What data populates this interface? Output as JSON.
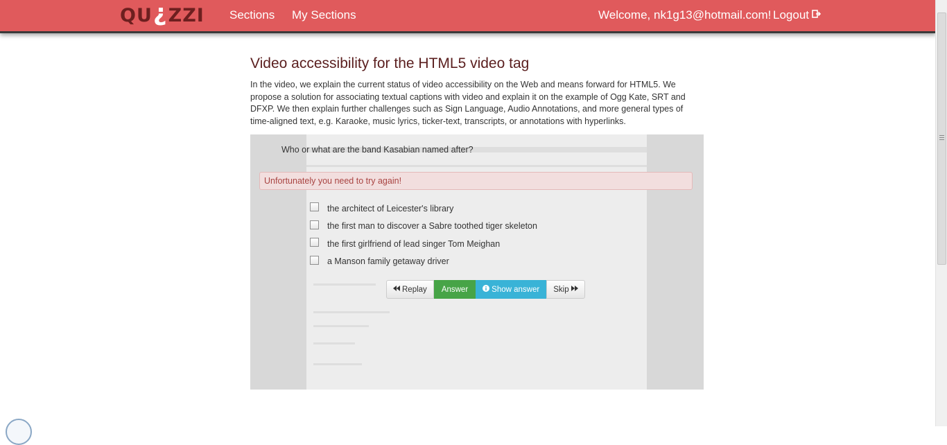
{
  "navbar": {
    "logo_left": "QU",
    "logo_mark": "¿",
    "logo_right": "ZZI",
    "links": [
      {
        "label": "Sections"
      },
      {
        "label": "My Sections"
      }
    ],
    "welcome": "Welcome, nk1g13@hotmail.com!",
    "logout": "Logout",
    "accent_color": "#e05a5c"
  },
  "page": {
    "title": "Video accessibility for the HTML5 video tag",
    "description": "In the video, we explain the current status of video accessibility on the Web and means forward for HTML5. We propose a solution for associating textual captions with video and explain it on the example of Ogg Kate, SRT and DFXP. We then explain further challenges such as Sign Language, Audio Annotations, and more general types of time-aligned text, e.g. Karaoke, music lyrics, ticker-text, transcripts, or annotations with hyperlinks."
  },
  "quiz": {
    "question": "Who or what are the band Kasabian named after?",
    "alert": "Unfortunately you need to try again!",
    "options": [
      {
        "label": "the architect of Leicester's library",
        "checked": false
      },
      {
        "label": "the first man to discover a Sabre toothed tiger skeleton",
        "checked": false
      },
      {
        "label": "the first girlfriend of lead singer Tom Meighan",
        "checked": false
      },
      {
        "label": "a Manson family getaway driver",
        "checked": false
      }
    ],
    "buttons": {
      "replay": "Replay",
      "answer": "Answer",
      "show_answer": "Show answer",
      "skip": "Skip"
    }
  }
}
